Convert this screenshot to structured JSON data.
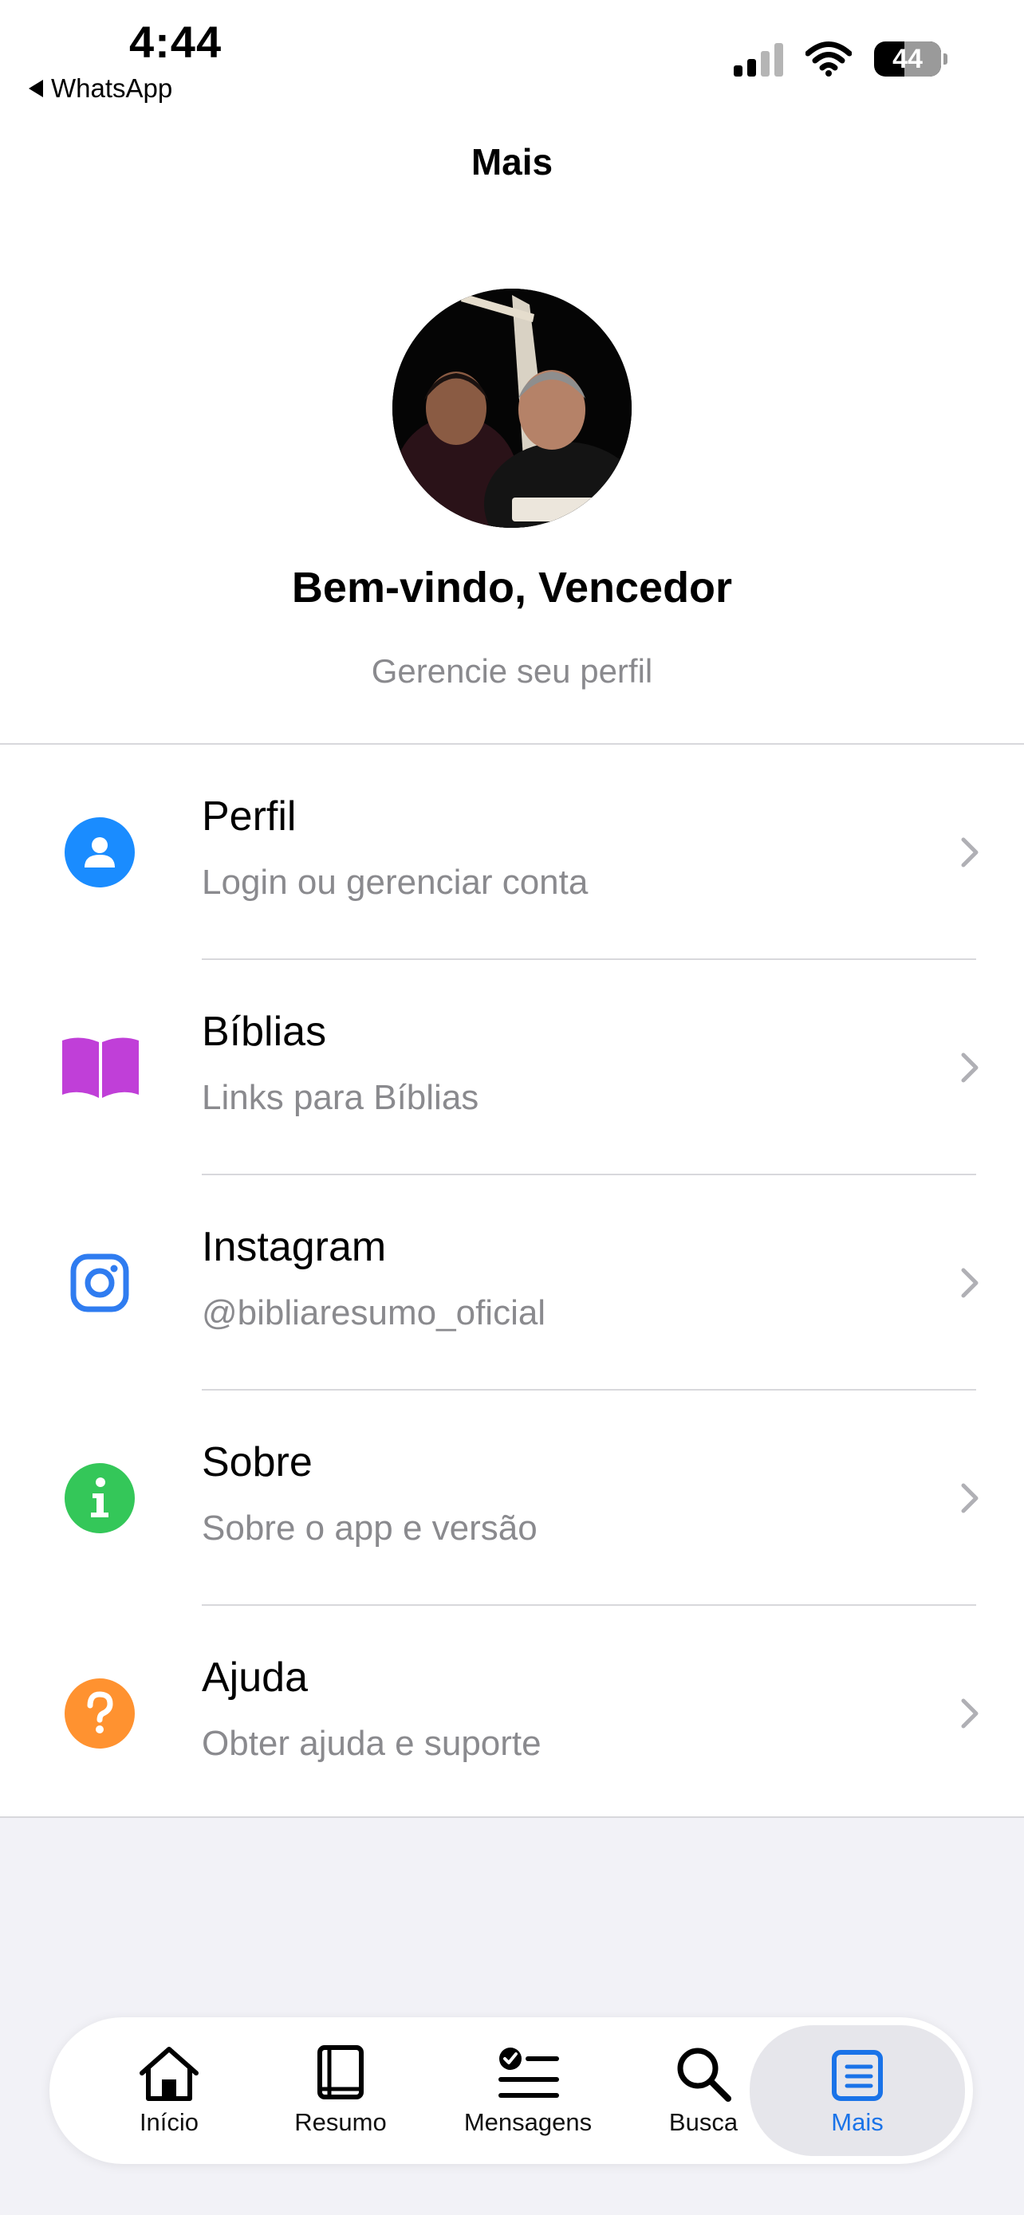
{
  "status_bar": {
    "time": "4:44",
    "back_app": "WhatsApp",
    "battery": "44"
  },
  "nav": {
    "title": "Mais"
  },
  "profile": {
    "welcome": "Bem-vindo, Vencedor",
    "subtitle": "Gerencie seu perfil",
    "avatar": "profile-photo"
  },
  "menu": [
    {
      "title": "Perfil",
      "subtitle": "Login ou gerenciar conta",
      "icon": "person-icon",
      "color": "#1a8cff"
    },
    {
      "title": "Bíblias",
      "subtitle": "Links para Bíblias",
      "icon": "book-icon",
      "color": "#c03fd8"
    },
    {
      "title": "Instagram",
      "subtitle": "@bibliaresumo_oficial",
      "icon": "instagram-icon",
      "color": "#2f7cf0"
    },
    {
      "title": "Sobre",
      "subtitle": "Sobre o app e versão",
      "icon": "info-icon",
      "color": "#34c759"
    },
    {
      "title": "Ajuda",
      "subtitle": "Obter ajuda e suporte",
      "icon": "help-icon",
      "color": "#ff9230"
    }
  ],
  "tabs": [
    {
      "label": "Início",
      "icon": "house-icon"
    },
    {
      "label": "Resumo",
      "icon": "book-icon"
    },
    {
      "label": "Mensagens",
      "icon": "checklist-icon"
    },
    {
      "label": "Busca",
      "icon": "search-icon"
    },
    {
      "label": "Mais",
      "icon": "list-icon",
      "active": true
    }
  ],
  "colors": {
    "accent": "#1a73e8",
    "secondary_text": "#8a8a8e",
    "background": "#f2f2f7"
  }
}
